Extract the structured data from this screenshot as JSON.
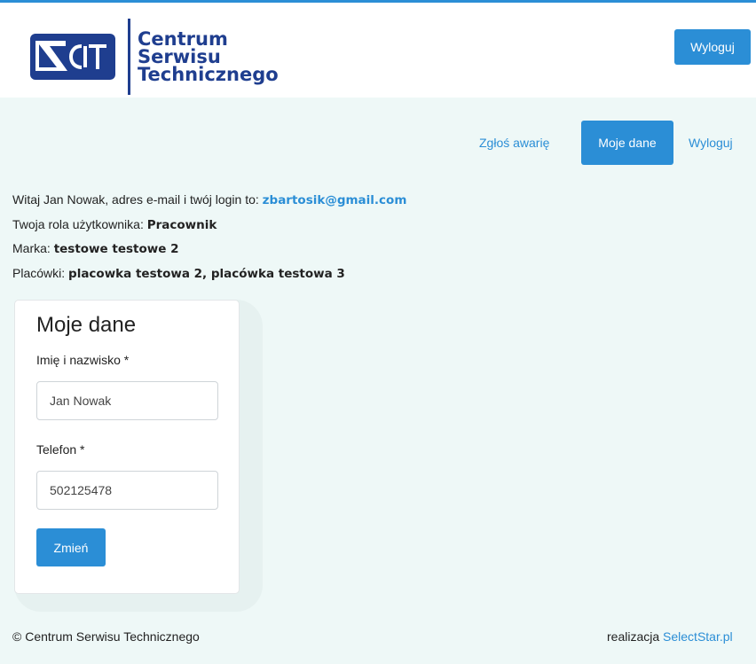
{
  "header": {
    "logo_lines": [
      "Centrum",
      "Serwisu",
      "Technicznego"
    ],
    "logo_mark_text": "CST",
    "logout_label": "Wyloguj"
  },
  "nav": {
    "report_label": "Zgłoś awarię",
    "my_data_label": "Moje dane",
    "logout_label": "Wyloguj"
  },
  "info": {
    "welcome_text": "Witaj Jan Nowak, adres e-mail i twój login to: ",
    "email": "zbartosik@gmail.com",
    "role_label": "Twoja rola użytkownika: ",
    "role_value": "Pracownik",
    "brand_label": "Marka: ",
    "brand_value": "testowe testowe 2",
    "branches_label": "Placówki: ",
    "branches_value": "placowka testowa 2, placówka testowa 3"
  },
  "form": {
    "title": "Moje dane",
    "name_label": "Imię i nazwisko *",
    "name_value": "Jan Nowak",
    "phone_label": "Telefon *",
    "phone_value": "502125478",
    "submit_label": "Zmień"
  },
  "footer": {
    "copyright": "© Centrum Serwisu Technicznego",
    "credit_text": "realizacja ",
    "credit_link": "SelectStar.pl"
  },
  "colors": {
    "accent": "#2b8ed6",
    "brand": "#1f3e8f",
    "background": "#eef8f7"
  }
}
